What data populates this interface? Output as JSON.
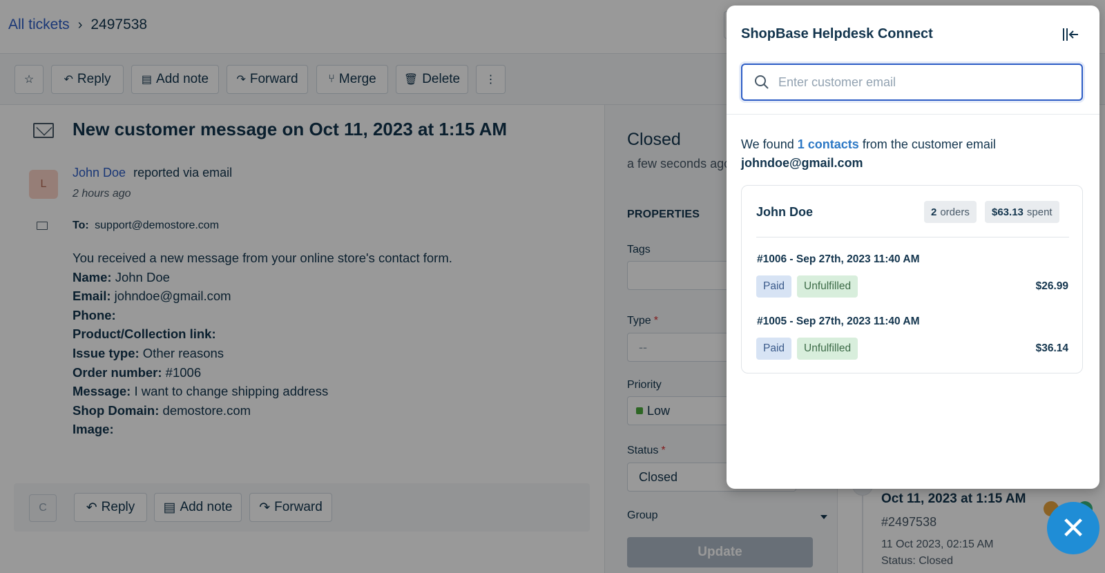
{
  "breadcrumb": {
    "root": "All tickets",
    "ticket_id": "2497538"
  },
  "toolbar": {
    "reply": "Reply",
    "add_note": "Add note",
    "forward": "Forward",
    "merge": "Merge",
    "delete": "Delete"
  },
  "ticket": {
    "subject": "New customer message on Oct 11, 2023 at 1:15 AM",
    "avatar_initial": "L",
    "reporter": "John Doe",
    "reported_via": "reported via email",
    "time_ago": "2 hours ago",
    "to_label": "To:",
    "to_value": "support@demostore.com",
    "intro": "You received a new message from your online store's contact form.",
    "fields": [
      {
        "label": "Name:",
        "value": "John Doe"
      },
      {
        "label": "Email:",
        "value": "johndoe@gmail.com"
      },
      {
        "label": "Phone:",
        "value": ""
      },
      {
        "label": "Product/Collection link:",
        "value": ""
      },
      {
        "label": "Issue type:",
        "value": "Other reasons"
      },
      {
        "label": "Order number:",
        "value": "#1006"
      },
      {
        "label": "Message:",
        "value": "I want to change shipping address"
      },
      {
        "label": "Shop Domain:",
        "value": "demostore.com"
      },
      {
        "label": "Image:",
        "value": ""
      }
    ]
  },
  "reply_bar": {
    "avatar_initial": "C",
    "reply": "Reply",
    "add_note": "Add note",
    "forward": "Forward"
  },
  "properties": {
    "status_title": "Closed",
    "status_ago": "a few seconds ago",
    "heading": "PROPERTIES",
    "tags_label": "Tags",
    "type_label": "Type",
    "type_placeholder": "--",
    "priority_label": "Priority",
    "priority_value": "Low",
    "status_label": "Status",
    "status_value": "Closed",
    "group_label": "Group",
    "required_mark": "*",
    "update_button": "Update"
  },
  "timeline": {
    "date": "Oct 11, 2023 at 1:15 AM",
    "ticket_ref": "#2497538",
    "when": "11 Oct 2023, 02:15 AM",
    "status": "Status: Closed"
  },
  "panel": {
    "title": "ShopBase Helpdesk Connect",
    "search_placeholder": "Enter customer email",
    "found_prefix": "We found",
    "found_link": "1 contacts",
    "found_suffix": "from the customer email",
    "found_email": "johndoe@gmail.com",
    "customer": {
      "name": "John Doe",
      "orders_count": "2",
      "orders_label": "orders",
      "spent_value": "$63.13",
      "spent_label": "spent"
    },
    "orders": [
      {
        "title": "#1006 - Sep 27th, 2023 11:40 AM",
        "payment": "Paid",
        "fulfillment": "Unfulfilled",
        "amount": "$26.99"
      },
      {
        "title": "#1005 - Sep 27th, 2023 11:40 AM",
        "payment": "Paid",
        "fulfillment": "Unfulfilled",
        "amount": "$36.14"
      }
    ]
  },
  "colors": {
    "accent": "#2c5cc5",
    "link": "#2c78c5",
    "fab": "#1f8dd6",
    "priority_low": "#4bab3c"
  }
}
